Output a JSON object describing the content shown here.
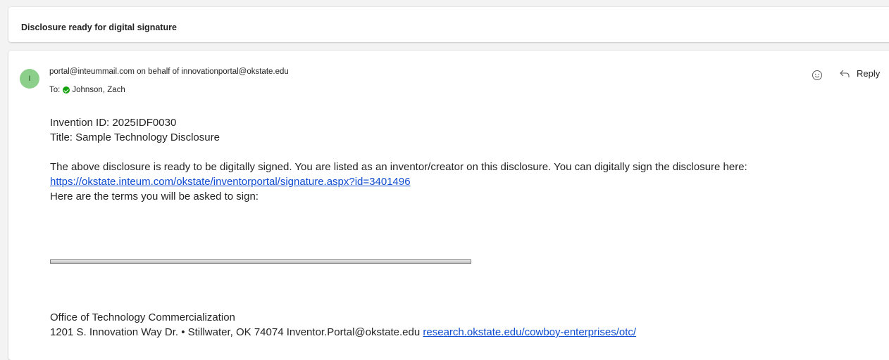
{
  "subject": "Disclosure ready for digital signature",
  "message": {
    "avatar_initial": "I",
    "sender": "portal@inteummail.com on behalf of innovationportal@okstate.edu",
    "to_label": "To:",
    "recipient": "Johnson, Zach",
    "reply_label": "Reply",
    "body": {
      "invention_id": "Invention ID: 2025IDF0030",
      "title": "Title: Sample Technology Disclosure",
      "paragraph": "The above disclosure is ready to be digitally signed. You are listed as an inventor/creator on this disclosure. You can digitally sign the disclosure here:",
      "signature_link": "https://okstate.inteum.com/okstate/inventorportal/signature.aspx?id=3401496",
      "terms_intro": "Here are the terms you will be asked to sign:"
    },
    "footer": {
      "office": "Office of Technology Commercialization",
      "address": "1201 S. Innovation Way Dr. • Stillwater, OK 74074 Inventor.Portal@okstate.edu",
      "website_link": "research.okstate.edu/cowboy-enterprises/otc/"
    }
  },
  "colors": {
    "avatar": "#8ccf8a",
    "presence": "#13a10e",
    "link": "#0f4cd1"
  }
}
